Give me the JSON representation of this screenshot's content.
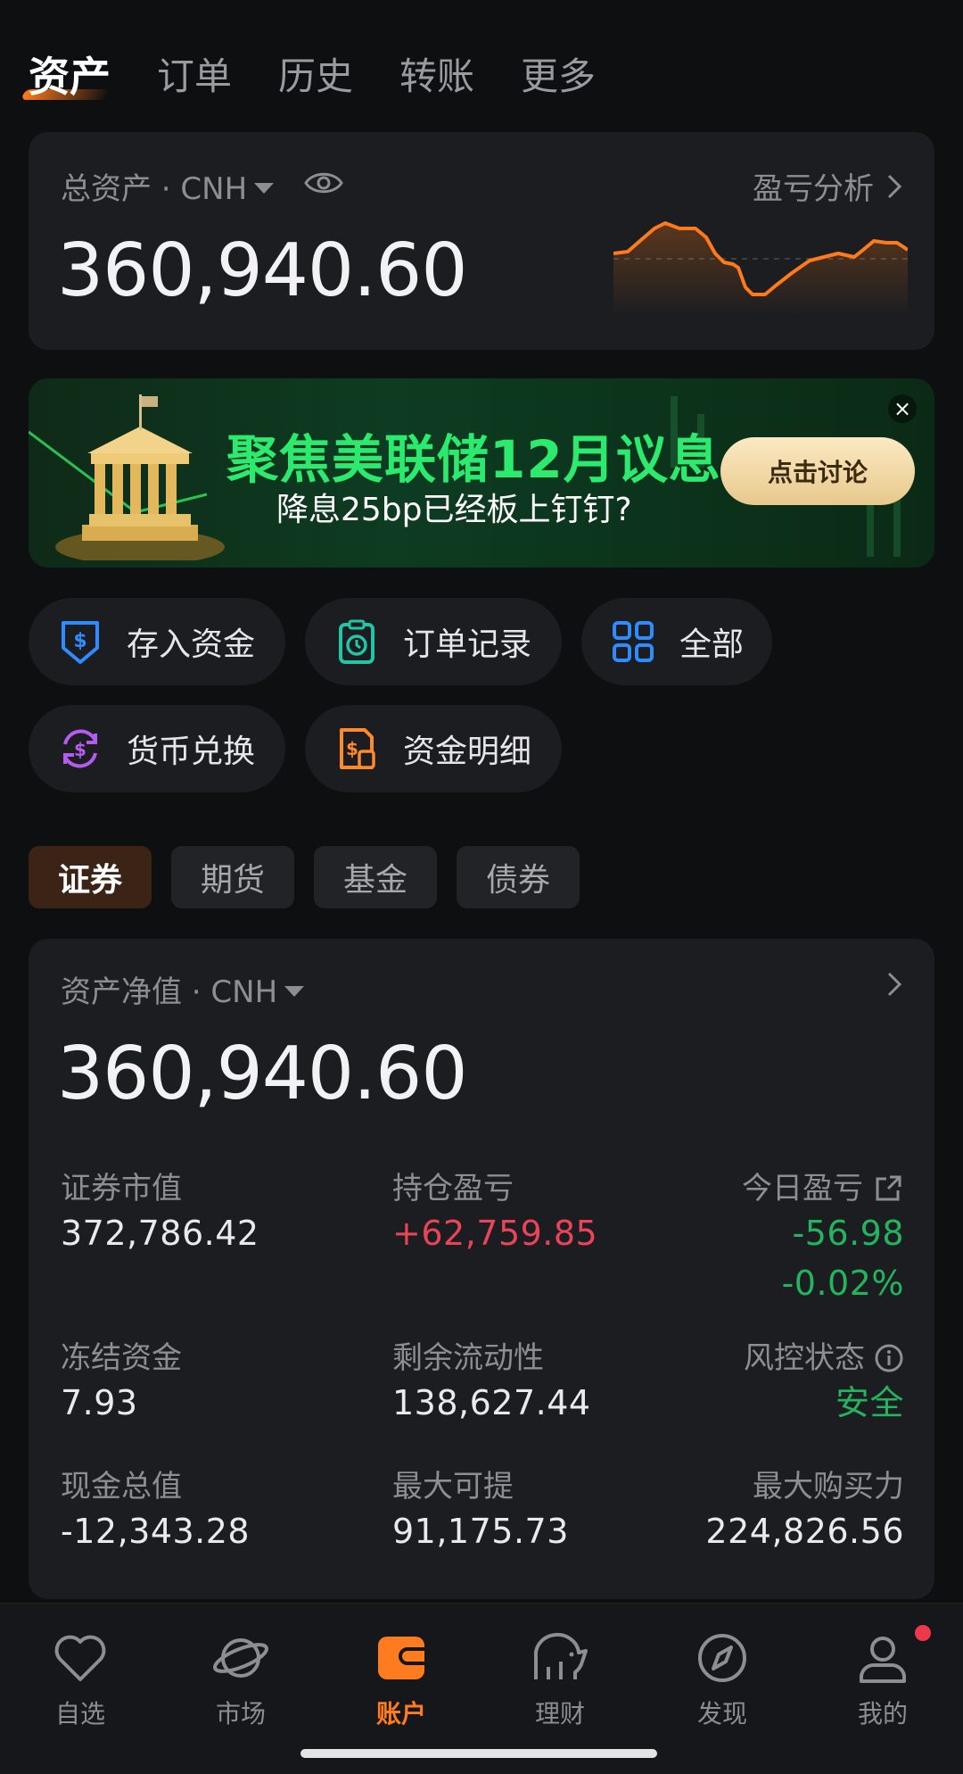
{
  "top_tabs": [
    {
      "label": "资产",
      "active": true
    },
    {
      "label": "订单",
      "active": false
    },
    {
      "label": "历史",
      "active": false
    },
    {
      "label": "转账",
      "active": false
    },
    {
      "label": "更多",
      "active": false
    }
  ],
  "asset_card": {
    "label": "总资产 · CNH",
    "value": "360,940.60",
    "pnl_link": "盈亏分析"
  },
  "banner": {
    "title": "聚焦美联储12月议息",
    "subtitle": "降息25bp已经板上钉钉?",
    "button": "点击讨论",
    "close": "×"
  },
  "shortcuts": [
    {
      "label": "存入资金",
      "icon": "deposit-icon",
      "color": "#2f8cff"
    },
    {
      "label": "订单记录",
      "icon": "order-clipboard-icon",
      "color": "#22c5a6"
    },
    {
      "label": "全部",
      "icon": "grid-icon",
      "color": "#2f8cff"
    },
    {
      "label": "货币兑换",
      "icon": "currency-exchange-icon",
      "color": "#b45cf0"
    },
    {
      "label": "资金明细",
      "icon": "fund-detail-icon",
      "color": "#ff8a2a"
    }
  ],
  "segments": [
    {
      "label": "证券",
      "active": true
    },
    {
      "label": "期货",
      "active": false
    },
    {
      "label": "基金",
      "active": false
    },
    {
      "label": "债券",
      "active": false
    }
  ],
  "net_card": {
    "label": "资产净值 · CNH",
    "value": "360,940.60",
    "stats": {
      "market_value": {
        "label": "证券市值",
        "value": "372,786.42"
      },
      "position_pnl": {
        "label": "持仓盈亏",
        "value": "+62,759.85"
      },
      "today_pnl": {
        "label": "今日盈亏",
        "value": "-56.98",
        "percent": "-0.02%"
      },
      "frozen": {
        "label": "冻结资金",
        "value": "7.93"
      },
      "liquidity": {
        "label": "剩余流动性",
        "value": "138,627.44"
      },
      "risk": {
        "label": "风控状态",
        "value": "安全"
      },
      "cash": {
        "label": "现金总值",
        "value": "-12,343.28"
      },
      "withdrawable": {
        "label": "最大可提",
        "value": "91,175.73"
      },
      "buying_power": {
        "label": "最大购买力",
        "value": "224,826.56"
      }
    }
  },
  "bottom_nav": [
    {
      "label": "自选",
      "icon": "heart-icon"
    },
    {
      "label": "市场",
      "icon": "planet-icon"
    },
    {
      "label": "账户",
      "icon": "wallet-icon",
      "active": true
    },
    {
      "label": "理财",
      "icon": "piggy-bank-icon"
    },
    {
      "label": "发现",
      "icon": "compass-icon"
    },
    {
      "label": "我的",
      "icon": "user-icon",
      "badge": true
    }
  ],
  "colors": {
    "accent": "#ff7b1f",
    "gain": "#e94458",
    "loss": "#22b45e",
    "background": "#0e0f11",
    "card": "#1c1d20"
  }
}
